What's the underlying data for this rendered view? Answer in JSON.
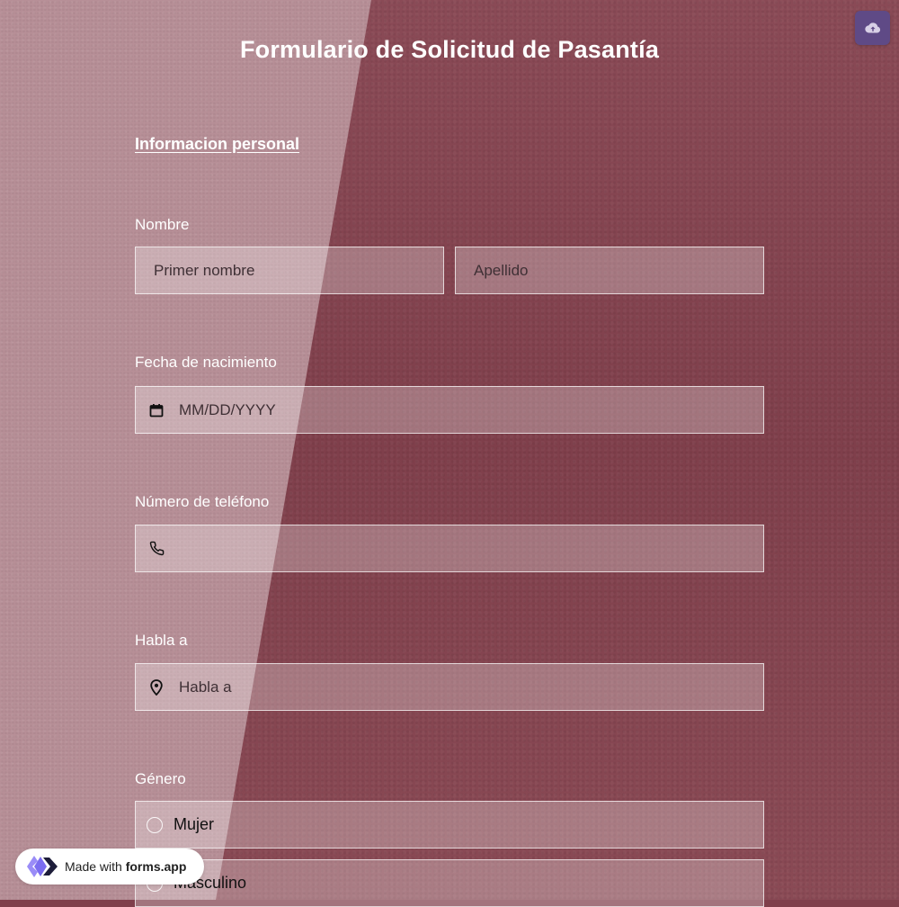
{
  "header": {
    "title": "Formulario de Solicitud de Pasantía",
    "upload_icon": "cloud-upload-icon"
  },
  "section": {
    "link_label": "Informacion personal"
  },
  "fields": {
    "name": {
      "label": "Nombre",
      "first_placeholder": "Primer nombre",
      "last_placeholder": "Apellido"
    },
    "birthdate": {
      "label": "Fecha de nacimiento",
      "placeholder": "MM/DD/YYYY",
      "icon": "calendar-icon"
    },
    "phone": {
      "label": "Número de teléfono",
      "placeholder": "",
      "icon": "phone-icon"
    },
    "address": {
      "label": "Habla a",
      "placeholder": "Habla a",
      "icon": "location-pin-icon"
    },
    "gender": {
      "label": "Género",
      "options": [
        "Mujer",
        "Masculino"
      ]
    }
  },
  "badge": {
    "prefix": "Made with ",
    "brand": "forms.app",
    "icon": "forms-app-logo-icon"
  },
  "colors": {
    "background_dark": "#7f3f4b",
    "background_light": "#b78f97",
    "upload_button": "#5f4a86",
    "text": "#ffffff"
  }
}
